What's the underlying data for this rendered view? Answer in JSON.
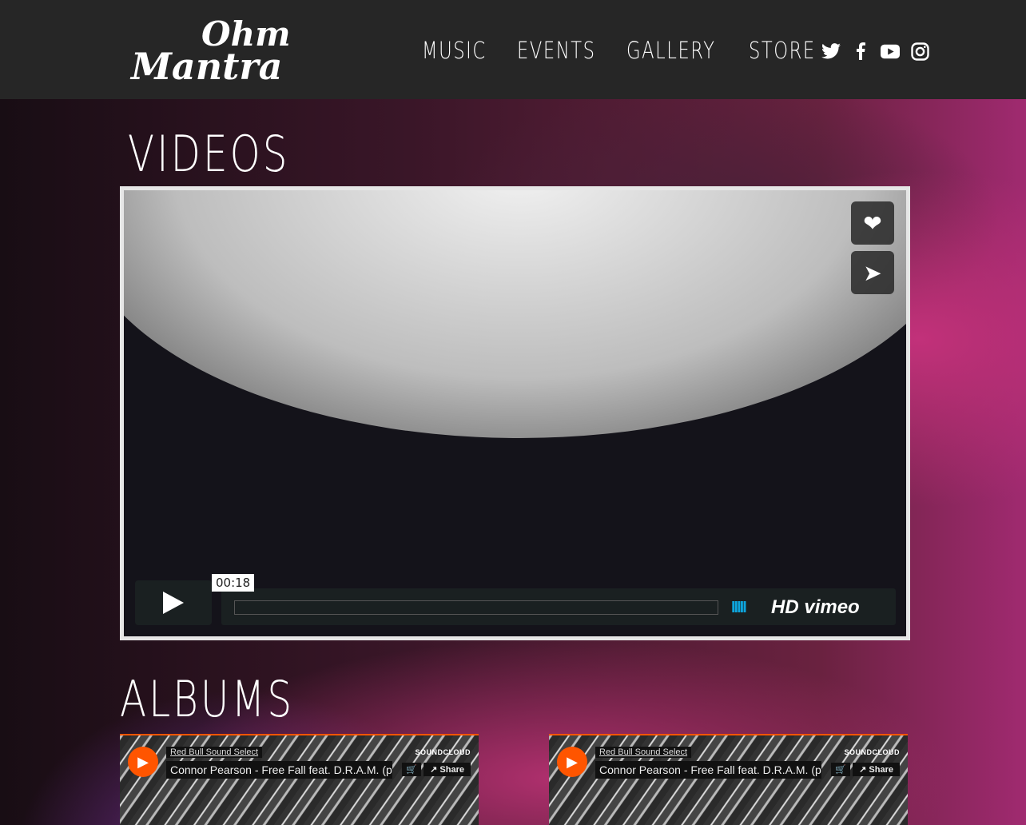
{
  "logo": {
    "line1": "Ohm",
    "line2": "Mantra"
  },
  "nav": [
    "MUSIC",
    "EVENTS",
    "GALLERY",
    "STORE"
  ],
  "social": [
    "twitter-icon",
    "facebook-icon",
    "youtube-icon",
    "instagram-icon"
  ],
  "videos": {
    "heading": "VIDEOS",
    "time": "00:18",
    "hd": "HD",
    "brand": "vimeo",
    "volume": "IIIII"
  },
  "albums": {
    "heading": "ALBUMS",
    "players": [
      {
        "user": "Red Bull Sound Select",
        "title": "Connor Pearson - Free Fall feat. D.R.A.M. (p...",
        "brand": "SOUNDCLOUD",
        "share": "Share"
      },
      {
        "user": "Red Bull Sound Select",
        "title": "Connor Pearson - Free Fall feat. D.R.A.M. (p...",
        "brand": "SOUNDCLOUD",
        "share": "Share"
      }
    ]
  }
}
